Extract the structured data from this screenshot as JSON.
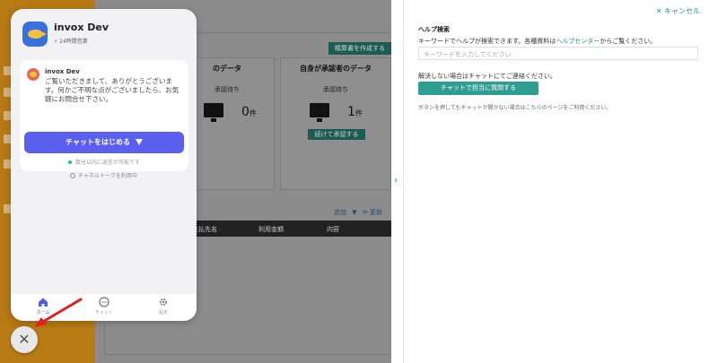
{
  "background_app": {
    "create_button_label": "精算書を作成する",
    "cards": [
      {
        "title": "のデータ",
        "subtitle": "承認待ち",
        "count": "0",
        "unit": "件"
      },
      {
        "title": "自身が承認者のデータ",
        "subtitle": "承認待ち",
        "count": "1",
        "unit": "件",
        "button_label": "続けて承認する"
      }
    ],
    "list_actions": {
      "add_label": "追加",
      "refresh_label": "更新"
    },
    "table_headers": [
      "支払先名",
      "利用金額",
      "内容"
    ]
  },
  "help_panel": {
    "cancel_label": "キャンセル",
    "title": "ヘルプ検索",
    "search_description_prefix": "キーワードでヘルプが検索できます。各種資料は",
    "help_center_link": "ヘルプセンター",
    "search_description_suffix": "からご覧ください。",
    "search_placeholder": "キーワードを入力してください",
    "unresolved_text": "解決しない場合はチャットにてご連絡ください。",
    "chat_button_label": "チャットで担当に質問する",
    "note_prefix": "ボタンを押してもチャットが開かない場合は",
    "note_link": "こちら",
    "note_suffix": "のページをご利用ください。"
  },
  "chat_widget": {
    "name": "invox Dev",
    "status": "24時間営業",
    "message_sender": "invox Dev",
    "message_text": "ご覧いただきまして、ありがとうございます。何かご不明な点がございましたら、お気軽にお問合せ下さい。",
    "start_button_label": "チャットをはじめる",
    "reply_time": "数分以内に返信が可能です",
    "channel_text": "チャネルトークを利用中",
    "tabs": [
      {
        "label": "ホーム",
        "icon": "home-icon"
      },
      {
        "label": "チャット",
        "icon": "chat-icon"
      },
      {
        "label": "設定",
        "icon": "gear-icon"
      }
    ]
  },
  "close_button_symbol": "✕",
  "colors": {
    "accent_purple": "#5b5ff0",
    "help_teal": "#2e9e93",
    "sidebar_orange": "#b77a15",
    "arrow_red": "#e02020"
  }
}
